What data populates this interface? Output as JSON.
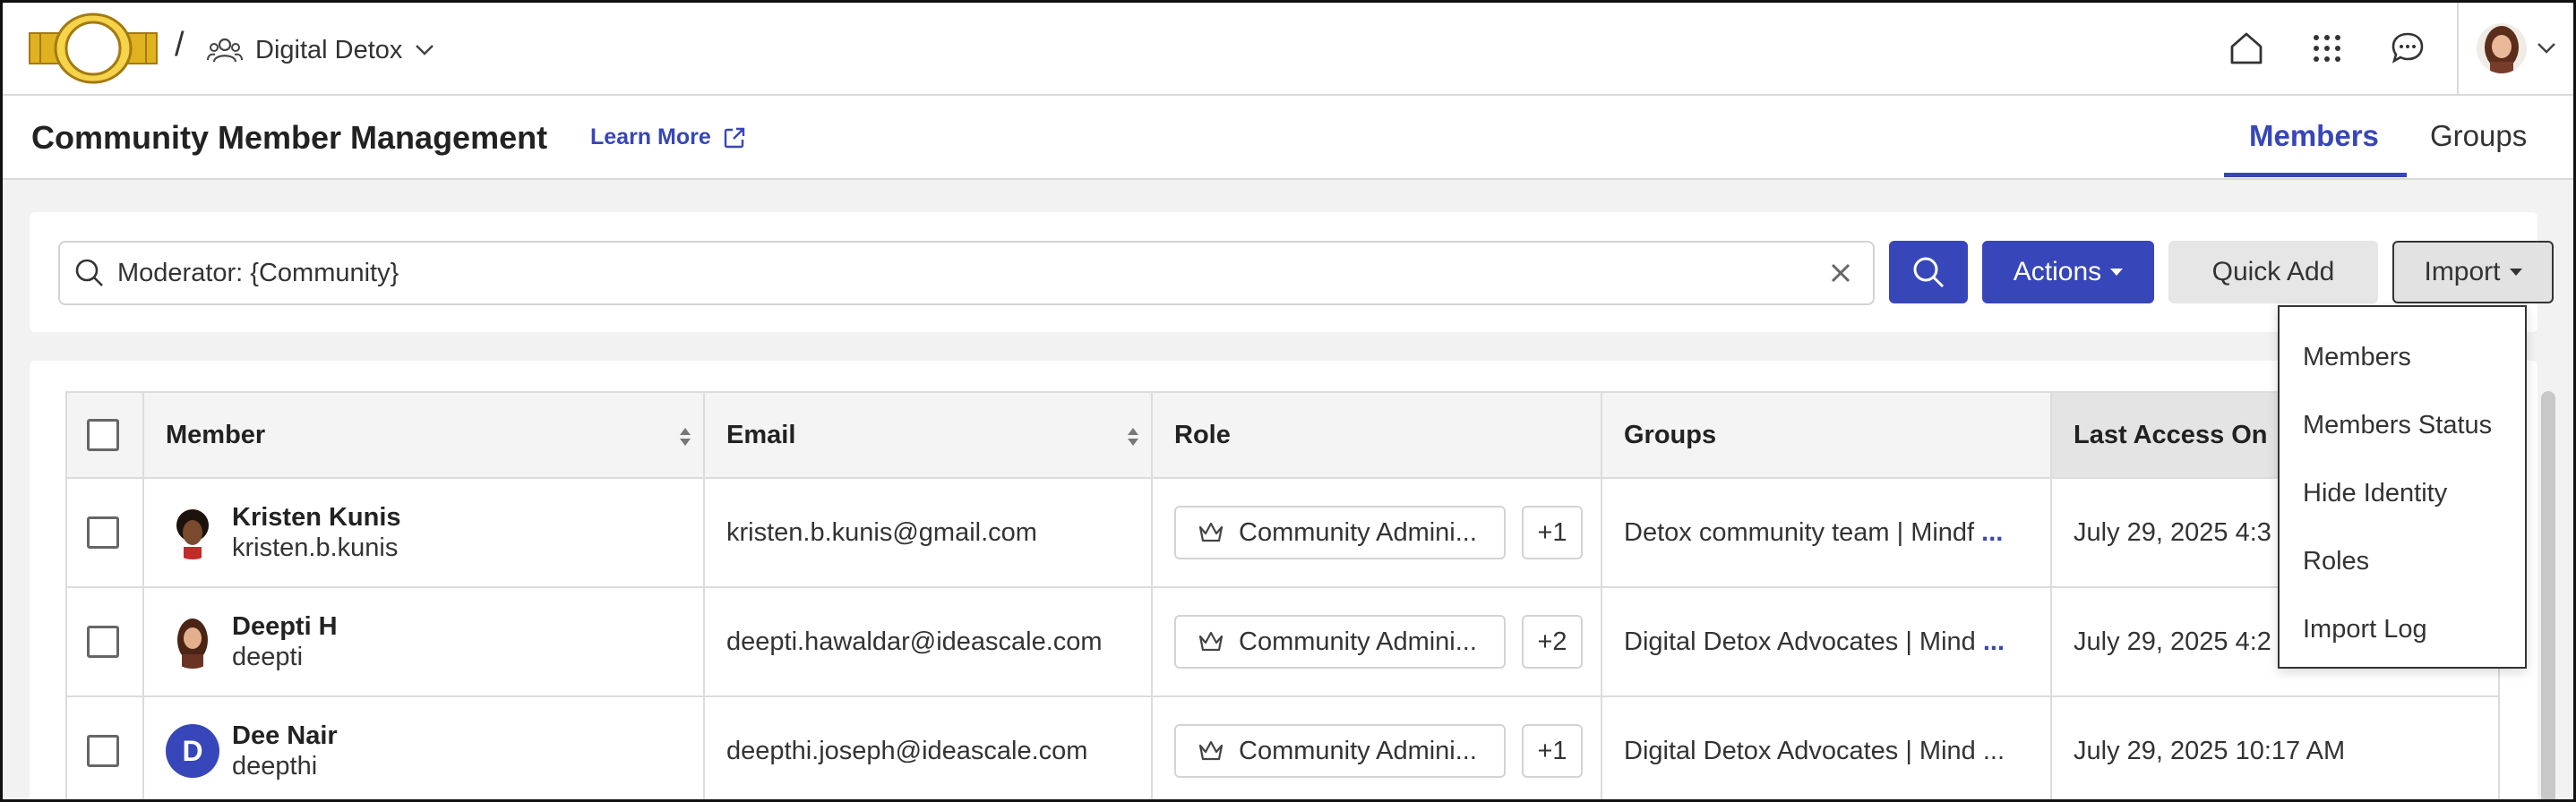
{
  "topbar": {
    "breadcrumb_separator": "/",
    "community_name": "Digital Detox",
    "icons": [
      "home-icon",
      "apps-grid-icon",
      "chat-icon",
      "user-avatar"
    ]
  },
  "header": {
    "title": "Community Member Management",
    "learn_more": "Learn More",
    "tabs": [
      {
        "label": "Members",
        "active": true
      },
      {
        "label": "Groups",
        "active": false
      }
    ]
  },
  "search": {
    "value": "Moderator: {Community}"
  },
  "buttons": {
    "actions": "Actions",
    "quick_add": "Quick Add",
    "import": "Import"
  },
  "import_menu": {
    "items": [
      "Members",
      "Members Status",
      "Hide Identity",
      "Roles",
      "Import Log"
    ]
  },
  "table": {
    "columns": [
      "Member",
      "Email",
      "Role",
      "Groups",
      "Last Access On"
    ],
    "rows": [
      {
        "name": "Kristen Kunis",
        "username": "kristen.b.kunis",
        "email": "kristen.b.kunis@gmail.com",
        "role": "Community Admini...",
        "role_extra": "+1",
        "groups": "Detox community team | Mindf",
        "groups_more": "...",
        "last_access": "July 29, 2025 4:3"
      },
      {
        "name": "Deepti H",
        "username": "deepti",
        "email": "deepti.hawaldar@ideascale.com",
        "role": "Community Admini...",
        "role_extra": "+2",
        "groups": "Digital Detox Advocates | Mind",
        "groups_more": "...",
        "last_access": "July 29, 2025 4:2"
      },
      {
        "name": "Dee Nair",
        "username": "deepthi",
        "avatar_letter": "D",
        "email": "deepthi.joseph@ideascale.com",
        "role": "Community Admini...",
        "role_extra": "+1",
        "groups": "Digital Detox Advocates | Mind ...",
        "groups_more": "",
        "last_access": "July 29, 2025 10:17 AM"
      }
    ]
  },
  "colors": {
    "accent": "#3746b8",
    "logo_gold": "#d4a017"
  }
}
